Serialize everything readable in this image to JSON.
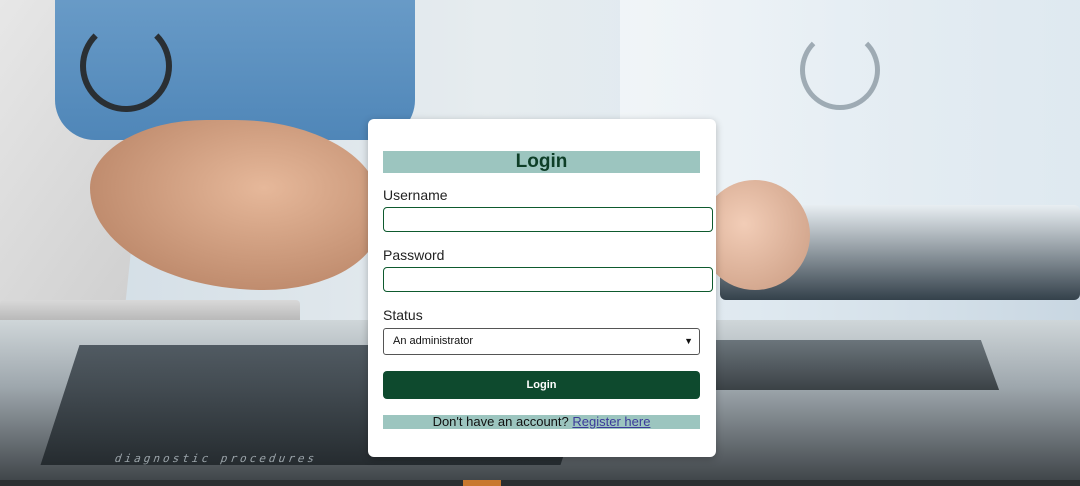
{
  "login_form": {
    "title": "Login",
    "username_label": "Username",
    "username_value": "",
    "password_label": "Password",
    "password_value": "",
    "status_label": "Status",
    "status_selected": "An administrator",
    "submit_label": "Login",
    "register_prompt": "Don't have an account?",
    "register_link": "Register here"
  },
  "background": {
    "desk_text": "diagnostic procedures"
  },
  "colors": {
    "title_band": "#9cc5bf",
    "primary_button": "#0e4a2e",
    "input_border": "#0e5a2e"
  },
  "icons": {
    "select_arrow": "chevron-down-icon"
  }
}
